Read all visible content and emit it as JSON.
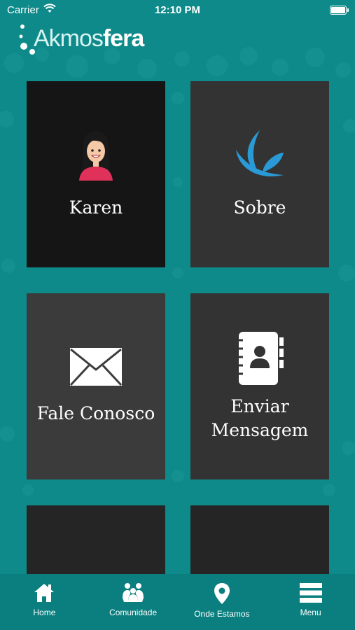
{
  "status_bar": {
    "carrier": "Carrier",
    "time": "12:10 PM"
  },
  "header": {
    "logo_text_part1": "Akmos",
    "logo_text_part2": "fera"
  },
  "tiles": [
    {
      "label": "Karen",
      "icon": "avatar-icon"
    },
    {
      "label": "Sobre",
      "icon": "leaf-logo-icon"
    },
    {
      "label": "Fale Conosco",
      "icon": "envelope-icon"
    },
    {
      "label_line1": "Enviar",
      "label_line2": "Mensagem",
      "icon": "contact-book-icon"
    },
    {
      "label": ""
    },
    {
      "label": ""
    }
  ],
  "tabbar": {
    "items": [
      {
        "label": "Home",
        "icon": "home-icon"
      },
      {
        "label": "Comunidade",
        "icon": "community-icon"
      },
      {
        "label": "Onde Estamos",
        "icon": "location-pin-icon"
      },
      {
        "label": "Menu",
        "icon": "hamburger-icon"
      }
    ]
  },
  "colors": {
    "background": "#0f8a8a",
    "tab_bar": "#0b7f7f",
    "accent_blue": "#2a9ad6"
  }
}
